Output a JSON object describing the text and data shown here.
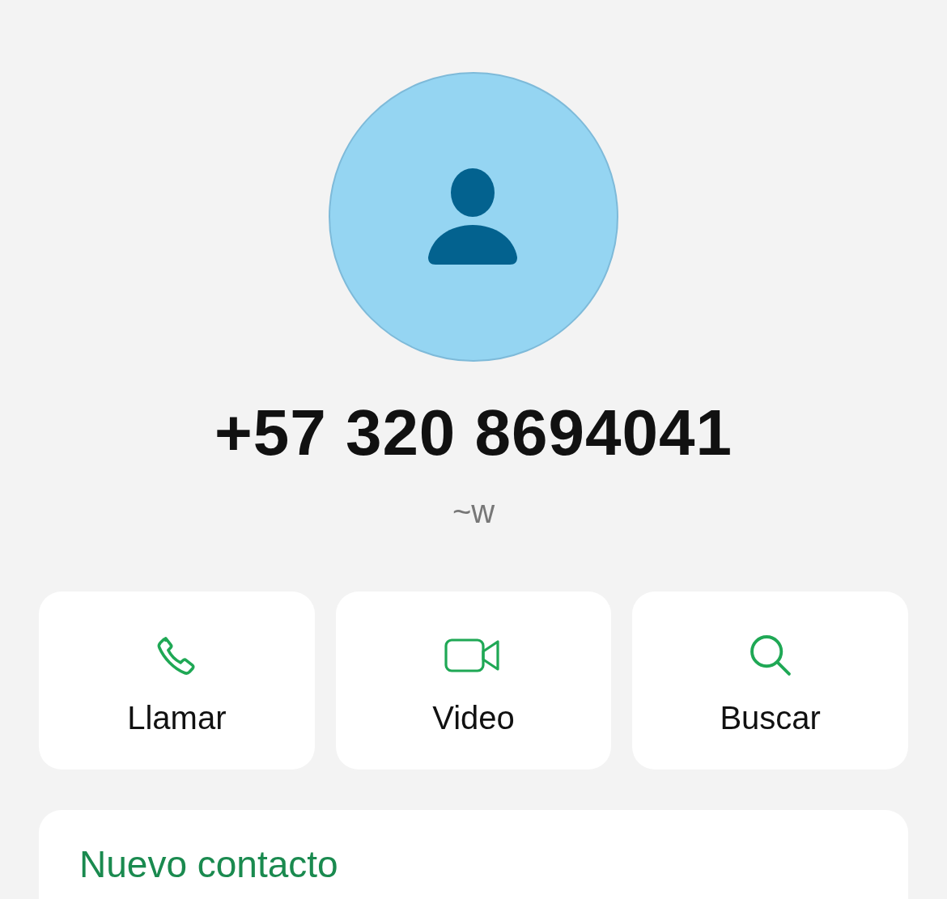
{
  "contact": {
    "phone": "+57 320 8694041",
    "name": "~w"
  },
  "actions": [
    {
      "kind": "call",
      "label": "Llamar"
    },
    {
      "kind": "video",
      "label": "Video"
    },
    {
      "kind": "search",
      "label": "Buscar"
    }
  ],
  "options": [
    {
      "label": "Nuevo contacto"
    }
  ]
}
